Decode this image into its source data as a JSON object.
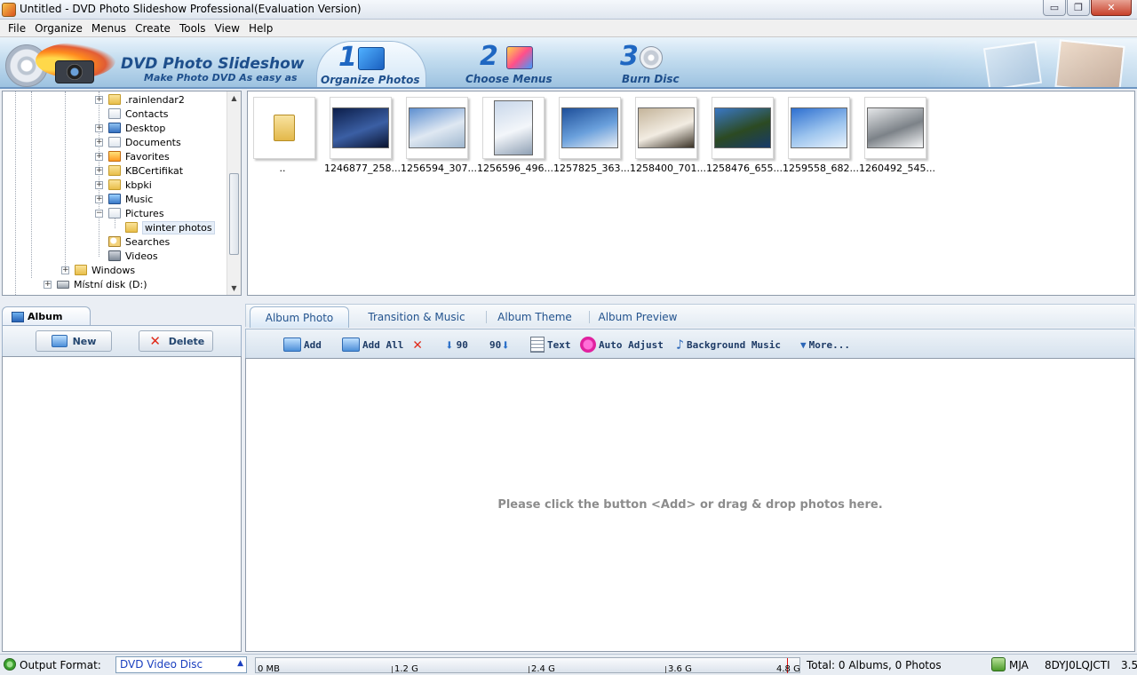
{
  "window": {
    "title": "Untitled - DVD Photo Slideshow Professional(Evaluation Version)",
    "min_glyph": "▭",
    "max_glyph": "❐",
    "close_glyph": "✕"
  },
  "menu": [
    "File",
    "Organize",
    "Menus",
    "Create",
    "Tools",
    "View",
    "Help"
  ],
  "banner": {
    "brand": "DVD Photo Slideshow",
    "slogan": "Make Photo DVD As easy as",
    "steps": [
      {
        "num": "1",
        "label": "Organize Photos"
      },
      {
        "num": "2",
        "label": "Choose Menus"
      },
      {
        "num": "3",
        "label": "Burn Disc"
      }
    ]
  },
  "tree": {
    "items": [
      {
        "label": ".rainlendar2",
        "icon": "folder-icon"
      },
      {
        "label": "Contacts",
        "icon": "contacts-icon"
      },
      {
        "label": "Desktop",
        "icon": "desktop-icon"
      },
      {
        "label": "Documents",
        "icon": "documents-icon"
      },
      {
        "label": "Favorites",
        "icon": "favorites-icon"
      },
      {
        "label": "KBCertifikat",
        "icon": "folder-icon"
      },
      {
        "label": "kbpki",
        "icon": "folder-icon"
      },
      {
        "label": "Music",
        "icon": "music-icon"
      },
      {
        "label": "Pictures",
        "icon": "pictures-icon"
      },
      {
        "label": "winter photos",
        "icon": "folder-icon"
      },
      {
        "label": "Searches",
        "icon": "searches-icon"
      },
      {
        "label": "Videos",
        "icon": "videos-icon"
      },
      {
        "label": "Windows",
        "icon": "folder-icon"
      },
      {
        "label": "Místní disk (D:)",
        "icon": "drive-icon"
      }
    ],
    "expand_glyph": "+",
    "collapse_glyph": "−",
    "scroll_up": "▲",
    "scroll_down": "▼"
  },
  "thumbnails": [
    {
      "caption": "..",
      "kind": "folder"
    },
    {
      "caption": "1246877_258...",
      "kind": "photo",
      "colors": [
        "#0c1e4a",
        "#3b5fa4",
        "#0a1430"
      ]
    },
    {
      "caption": "1256594_307...",
      "kind": "photo",
      "colors": [
        "#5d8fd0",
        "#dfe8f2",
        "#9fb7cf"
      ]
    },
    {
      "caption": "1256596_496...",
      "kind": "photo-tall",
      "colors": [
        "#c8d7ea",
        "#f3f6fa",
        "#8fa0b4"
      ]
    },
    {
      "caption": "1257825_363...",
      "kind": "photo",
      "colors": [
        "#1e4f9a",
        "#6aa0dc",
        "#e9eef4"
      ]
    },
    {
      "caption": "1258400_701...",
      "kind": "photo",
      "colors": [
        "#c4b49a",
        "#f2ece2",
        "#3a3226"
      ]
    },
    {
      "caption": "1258476_655...",
      "kind": "photo",
      "colors": [
        "#3a78c6",
        "#2c4a22",
        "#173a6a"
      ]
    },
    {
      "caption": "1259558_682...",
      "kind": "photo",
      "colors": [
        "#2d6fd0",
        "#9cc4ee",
        "#e8f2fc"
      ]
    },
    {
      "caption": "1260492_545...",
      "kind": "photo",
      "colors": [
        "#e4e6e8",
        "#7c8288",
        "#f6f7f8"
      ]
    }
  ],
  "album": {
    "tab_label": "Album",
    "new_label": "New",
    "delete_label": "Delete",
    "delete_glyph": "✕"
  },
  "tabs": [
    "Album Photo",
    "Transition & Music",
    "Album Theme",
    "Album Preview"
  ],
  "photo_toolbar": {
    "add": "Add",
    "add_all": "Add All",
    "remove_glyph": "✕",
    "rotate_left_glyph": "⬇",
    "rotate_left": "90",
    "rotate_right": "90",
    "rotate_right_glyph": "⬇",
    "text": "Text",
    "auto_adjust": "Auto Adjust",
    "music_glyph": "♪",
    "background_music": "Background Music",
    "more_glyph": "▼",
    "more": "More..."
  },
  "photo_area": {
    "hint": "Please click the button <Add> or drag & drop photos here."
  },
  "status": {
    "output_label": "Output Format:",
    "output_value": "DVD Video Disc",
    "output_dropdown_glyph": "▲",
    "capacity_ticks": [
      "0 MB",
      "1.2 G",
      "2.4 G",
      "3.6 G",
      "4.8 G"
    ],
    "capacity_used_fraction": 0.0,
    "total": "Total: 0 Albums, 0 Photos",
    "user": "MJA",
    "code": "8DYJ0LQJCTI",
    "version": "3.5"
  },
  "colors": {
    "accent": "#1e4f8c",
    "banner_top": "#e9f3fb",
    "banner_bottom": "#9dc2e0"
  }
}
